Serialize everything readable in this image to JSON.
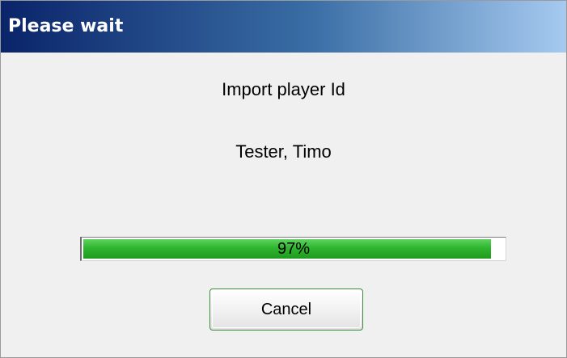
{
  "dialog": {
    "title": "Please wait",
    "message_line1": "Import player Id",
    "message_line2": "Tester, Timo",
    "progress": {
      "value": 0.97,
      "label": "97%"
    },
    "cancel_label": "Cancel"
  },
  "colors": {
    "title_gradient_start": "#0a246a",
    "title_gradient_end": "#a6caf0",
    "progress_green": "#2fb52f"
  }
}
